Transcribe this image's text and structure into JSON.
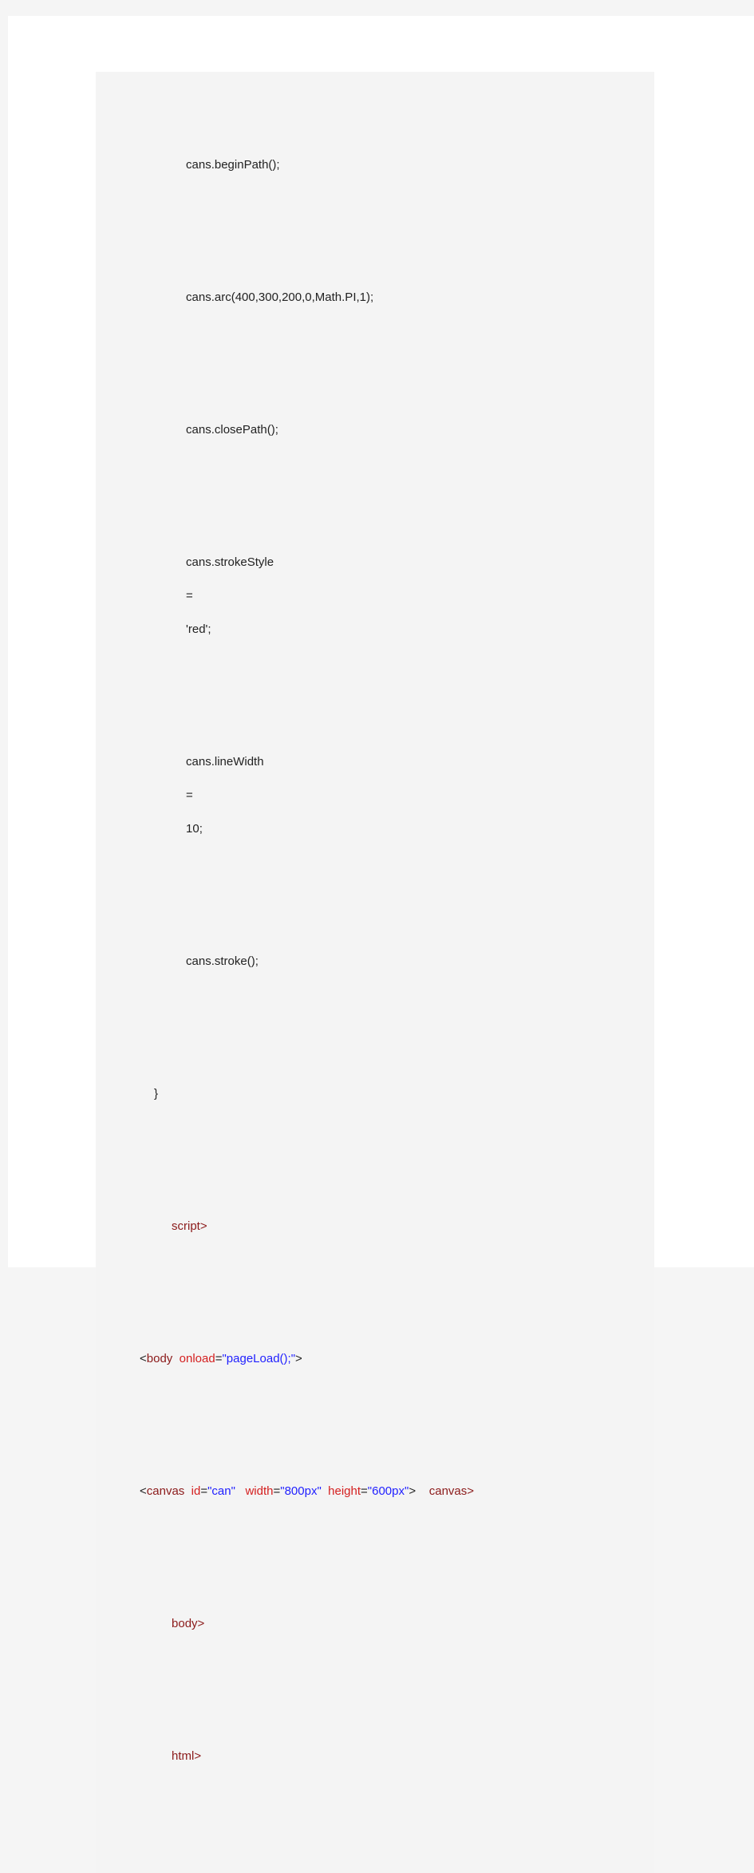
{
  "code": {
    "l1": "cans.beginPath();",
    "l2": "cans.arc(400,300,200,0,Math.PI,1);",
    "l3": "cans.closePath();",
    "l4a": "cans.strokeStyle",
    "l4b": "=",
    "l4c": "'red';",
    "l5a": "cans.lineWidth",
    "l5b": "=",
    "l5c": "10;",
    "l6": "cans.stroke();",
    "l7": "}",
    "l8": "script>",
    "l9_open": "<",
    "l9_tag": "body",
    "l9_attr": "onload",
    "l9_eq": "=",
    "l9_val": "\"pageLoad();\"",
    "l9_close": ">",
    "l10_open": "<",
    "l10_tag": "canvas",
    "l10_attr1": "id",
    "l10_eq1": "=",
    "l10_val1": "\"can\"",
    "l10_attr2": "width",
    "l10_eq2": "=",
    "l10_val2": "\"800px\"",
    "l10_attr3": "height",
    "l10_eq3": "=",
    "l10_val3": "\"600px\"",
    "l10_close": ">",
    "l10_endtag": "canvas>",
    "l11": "body>",
    "l12": "html>"
  }
}
